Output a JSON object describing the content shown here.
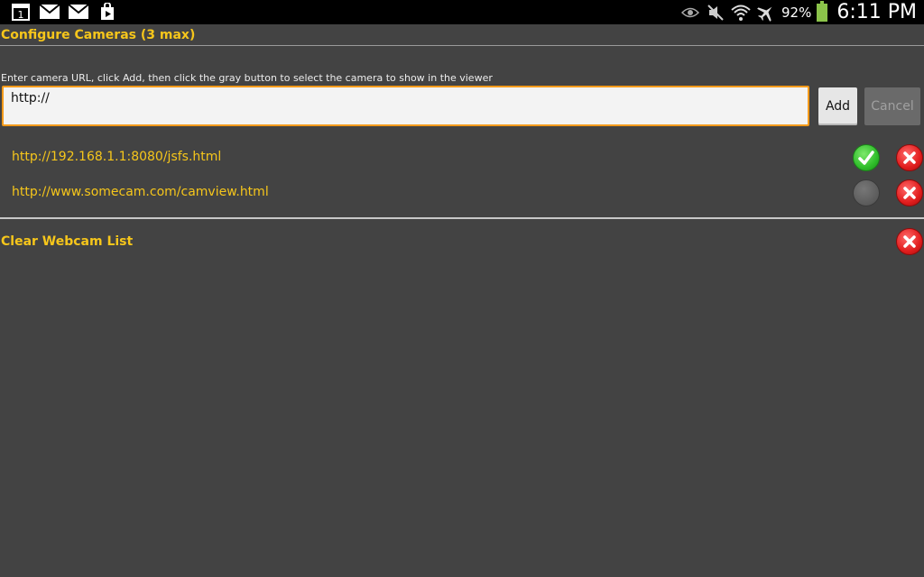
{
  "status_bar": {
    "left_icons": [
      "calendar-icon",
      "mail-icon",
      "mail-icon",
      "play-store-icon"
    ],
    "calendar_day": "1",
    "right_icons": [
      "eye-icon",
      "mute-icon",
      "wifi-icon",
      "airplane-icon"
    ],
    "battery_percent": "92%",
    "battery_level": 0.92,
    "time": "6:11 PM"
  },
  "header": {
    "title": "Configure Cameras (3 max)"
  },
  "form": {
    "instructions": "Enter camera URL, click Add, then click the gray button to select the camera to show in the viewer",
    "url_value": "http://",
    "add_label": "Add",
    "cancel_label": "Cancel"
  },
  "cameras": [
    {
      "url": "http://192.168.1.1:8080/jsfs.html",
      "selected": true
    },
    {
      "url": "http://www.somecam.com/camview.html",
      "selected": false
    }
  ],
  "clear_label": "Clear Webcam List",
  "colors": {
    "background": "#434343",
    "accent_yellow": "#f6c61b",
    "input_border": "#f39a1a",
    "select_green": "#2fbe2a",
    "delete_red": "#e11d1d"
  }
}
